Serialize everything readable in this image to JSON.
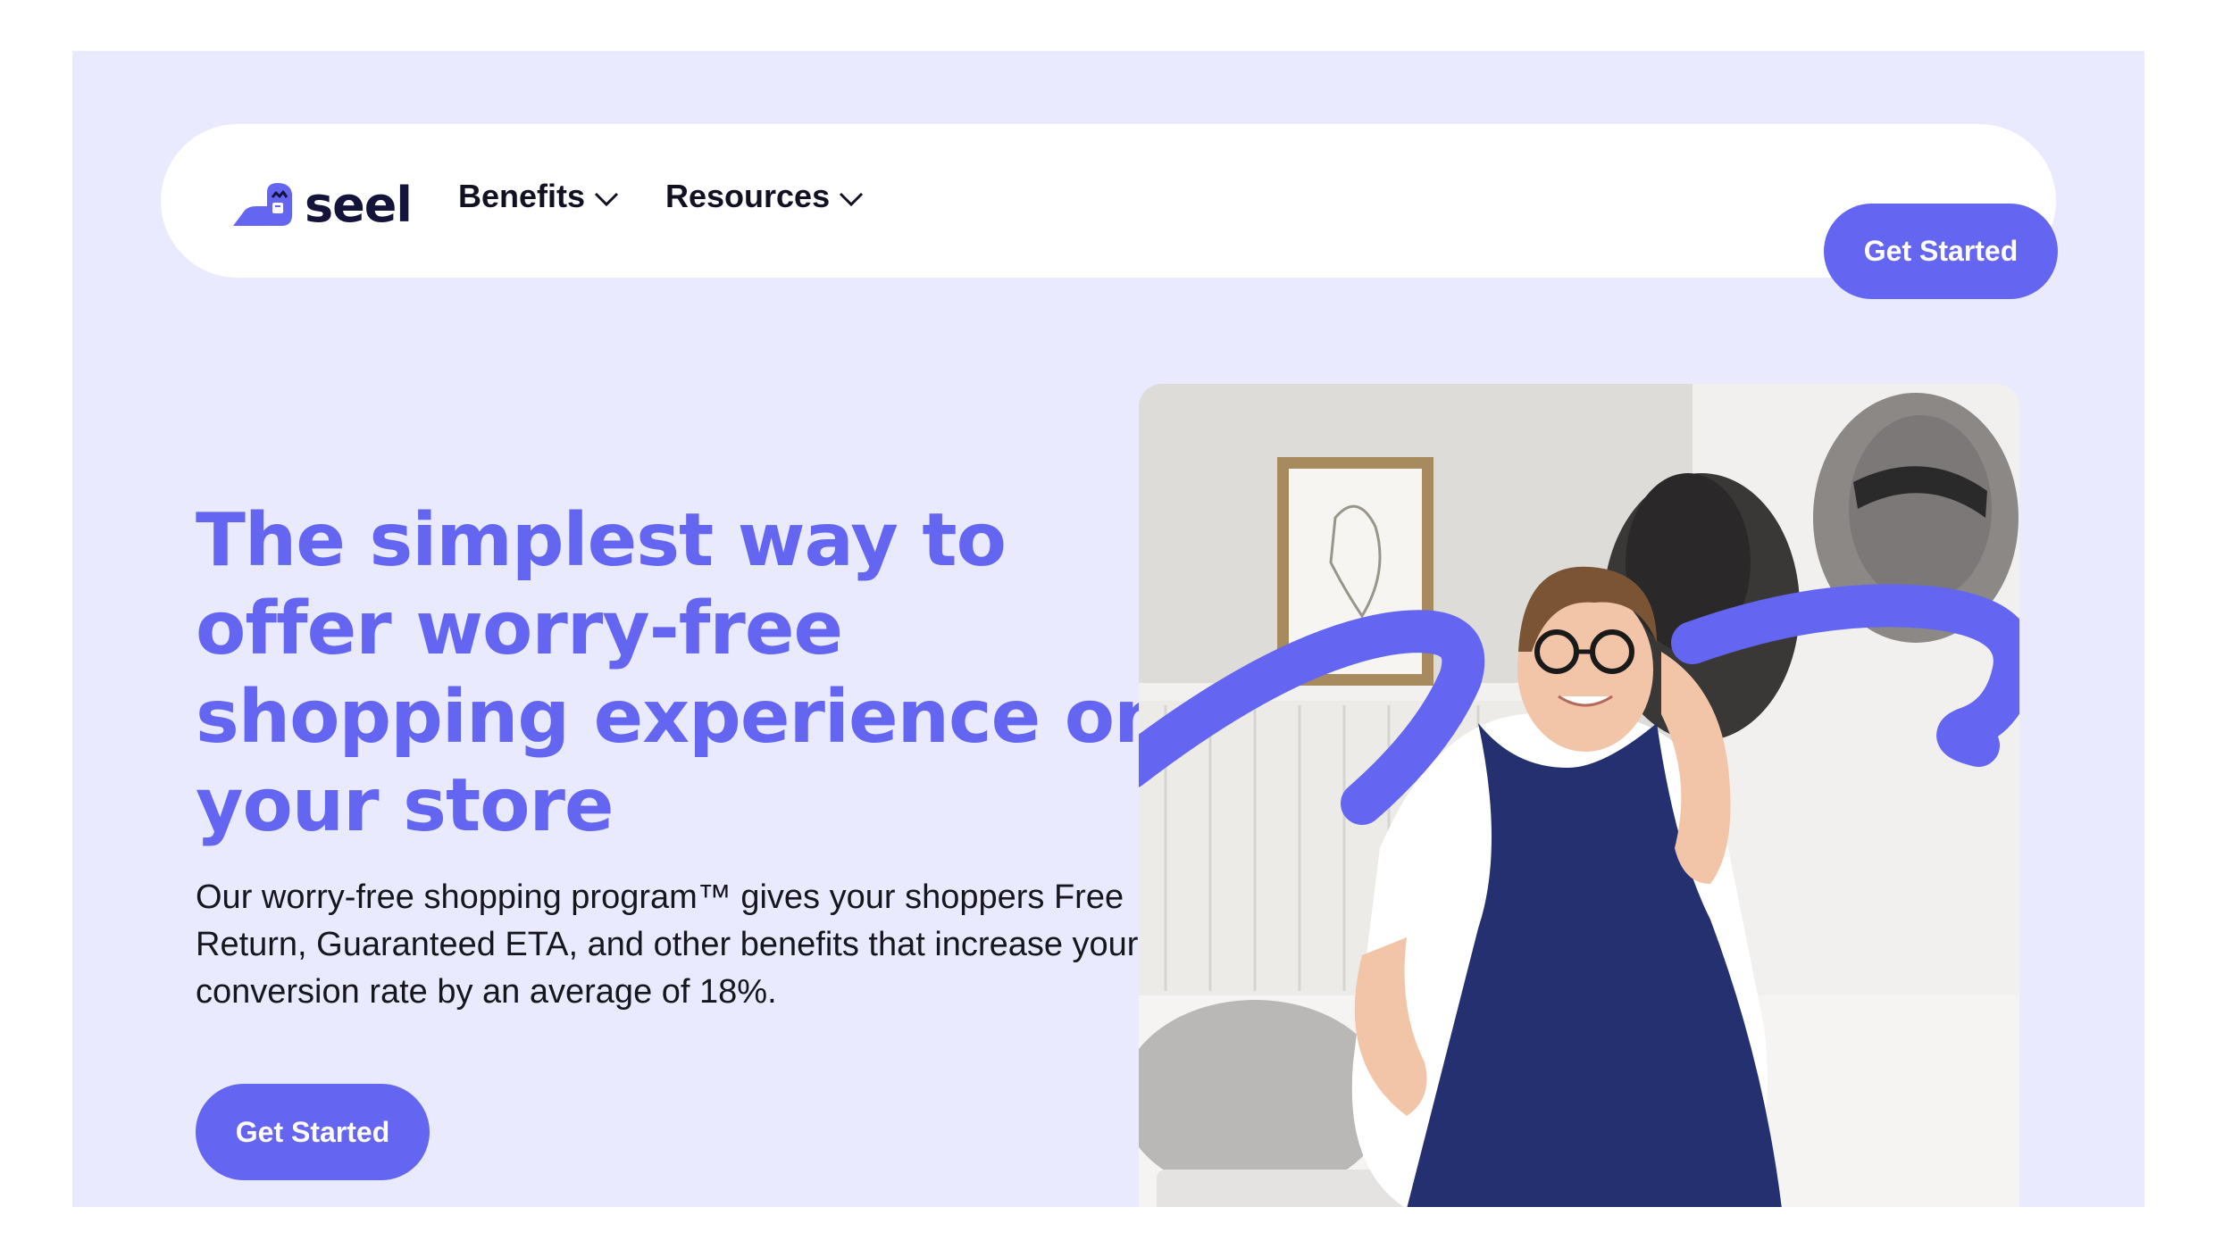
{
  "brand": {
    "name": "seel",
    "logo_icon": "seel-logo-icon"
  },
  "nav": {
    "items": [
      {
        "label": "Benefits",
        "icon": "chevron-down-icon"
      },
      {
        "label": "Resources",
        "icon": "chevron-down-icon"
      }
    ],
    "cta_label": "Get Started"
  },
  "hero": {
    "title": "The simplest way to offer worry-free shopping experience on your store",
    "subtitle": "Our worry-free shopping program™ gives your shoppers Free Return, Guaranteed ETA, and other benefits that increase your conversion rate by an average of 18%.",
    "cta_label": "Get Started",
    "image": "smiling-woman-in-bedroom-photo"
  },
  "colors": {
    "accent": "#6466f1",
    "background": "#e9eafd",
    "text_dark": "#16161f"
  }
}
